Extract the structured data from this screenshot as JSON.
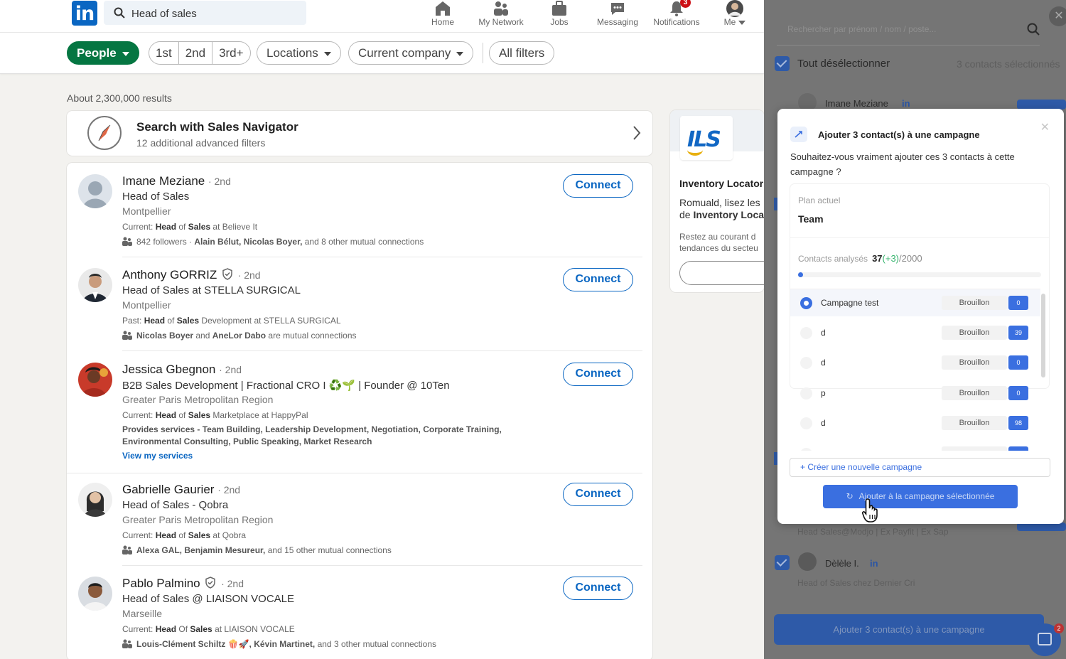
{
  "search": {
    "value": "Head of sales"
  },
  "nav": [
    {
      "label": "Home",
      "icon": "home-icon"
    },
    {
      "label": "My Network",
      "icon": "network-icon"
    },
    {
      "label": "Jobs",
      "icon": "briefcase-icon"
    },
    {
      "label": "Messaging",
      "icon": "messaging-icon"
    },
    {
      "label": "Notifications",
      "icon": "bell-icon",
      "badge": "3"
    },
    {
      "label": "Me",
      "icon": "avatar"
    }
  ],
  "filters": {
    "people": "People",
    "degrees": [
      "1st",
      "2nd",
      "3rd+"
    ],
    "locations": "Locations",
    "current_company": "Current company",
    "all_filters": "All filters"
  },
  "results_count": "About 2,300,000 results",
  "sales_nav": {
    "title": "Search with Sales Navigator",
    "subtitle": "12 additional advanced filters"
  },
  "people": [
    {
      "name": "Imane Meziane",
      "degree": "· 2nd",
      "headline": "Head of Sales",
      "location": "Montpellier",
      "current": [
        "Current: ",
        "Head",
        " of ",
        "Sales",
        " at Believe It"
      ],
      "mutual": [
        "842 followers · ",
        "Alain Bélut, Nicolas Boyer,",
        " and 8 other mutual connections"
      ],
      "connect": "Connect"
    },
    {
      "name": "Anthony GORRIZ",
      "degree": "· 2nd",
      "headline": "Head of Sales at STELLA SURGICAL",
      "location": "Montpellier",
      "current": [
        "Past: ",
        "Head",
        " of ",
        "Sales",
        " Development at STELLA SURGICAL"
      ],
      "mutual": [
        "",
        "Nicolas Boyer",
        " and ",
        "AneLor Dabo",
        " are mutual connections"
      ],
      "connect": "Connect"
    },
    {
      "name": "Jessica Gbegnon",
      "degree": "· 2nd",
      "headline": "B2B Sales Development | Fractional CRO I ♻️🌱 | Founder @ 10Ten",
      "location": "Greater Paris Metropolitan Region",
      "current": [
        "Current: ",
        "Head",
        " of ",
        "Sales",
        " Marketplace at HappyPal"
      ],
      "services": "Provides services - Team Building, Leadership Development, Negotiation, Corporate Training, Environmental Consulting, Public Speaking, Market Research",
      "services_link": "View my services",
      "connect": "Connect"
    },
    {
      "name": "Gabrielle Gaurier",
      "degree": "· 2nd",
      "headline": "Head of Sales - Qobra",
      "location": "Greater Paris Metropolitan Region",
      "current": [
        "Current: ",
        "Head",
        " of ",
        "Sales",
        " at Qobra"
      ],
      "mutual": [
        "",
        "Alexa GAL, Benjamin Mesureur,",
        " and 15 other mutual connections"
      ],
      "connect": "Connect"
    },
    {
      "name": "Pablo Palmino",
      "degree": "· 2nd",
      "headline": "Head of Sales @ LIAISON VOCALE",
      "location": "Marseille",
      "current": [
        "Current: ",
        "Head",
        " Of ",
        "Sales",
        " at LIAISON VOCALE"
      ],
      "mutual": [
        "",
        "Louis-Clément Schiltz 🍿🚀, Kévin Martinet,",
        " and 3 other mutual connections"
      ],
      "connect": "Connect"
    }
  ],
  "ad": {
    "logo_text": "ILS",
    "title": "Inventory Locator",
    "body_line1": "Romuald, lisez les",
    "body_line2_prefix": "de ",
    "body_line2_bold": "Inventory Loca",
    "small_line1": "Restez au courant d",
    "small_line2": "tendances du secteu"
  },
  "side_panel": {
    "search_placeholder": "Rechercher par prénom / nom / poste...",
    "deselect": "Tout désélectionner",
    "selected_count": "3 contacts sélectionnés",
    "contact1_name": "Imane Meziane",
    "contact_headline": "Head Sales@Modjo | Ex Payfit | Ex Sap",
    "contact3_name": "Dèlèle I.",
    "contact3_sub": "Head of Sales chez Dernier Cri",
    "in_label": "in",
    "bottom_button": "Ajouter 3 contact(s) à une campagne",
    "chat_badge": "2"
  },
  "modal": {
    "title": "Ajouter 3 contact(s) à une campagne",
    "question": "Souhaitez-vous vraiment ajouter ces 3 contacts à cette campagne ?",
    "plan_label": "Plan actuel",
    "plan_value": "Team",
    "analyzed_label": "Contacts analysés",
    "analyzed_value": "37",
    "analyzed_plus": "(+3)",
    "analyzed_total": "/2000",
    "analyzed_fraction": 0.0185,
    "campaigns": [
      {
        "name": "Campagne test",
        "status": "Brouillon",
        "count": "0",
        "selected": true
      },
      {
        "name": "d",
        "status": "Brouillon",
        "count": "39",
        "selected": false
      },
      {
        "name": "d",
        "status": "Brouillon",
        "count": "0",
        "selected": false
      },
      {
        "name": "p",
        "status": "Brouillon",
        "count": "0",
        "selected": false
      },
      {
        "name": "d",
        "status": "Brouillon",
        "count": "98",
        "selected": false
      }
    ],
    "new_campaign": "+ Créer une nouvelle campagne",
    "add_button": "Ajouter à la campagne sélectionnée"
  },
  "colors": {
    "linkedin_blue": "#0a66c2",
    "people_green": "#057642",
    "ext_blue": "#3a6fe0"
  }
}
